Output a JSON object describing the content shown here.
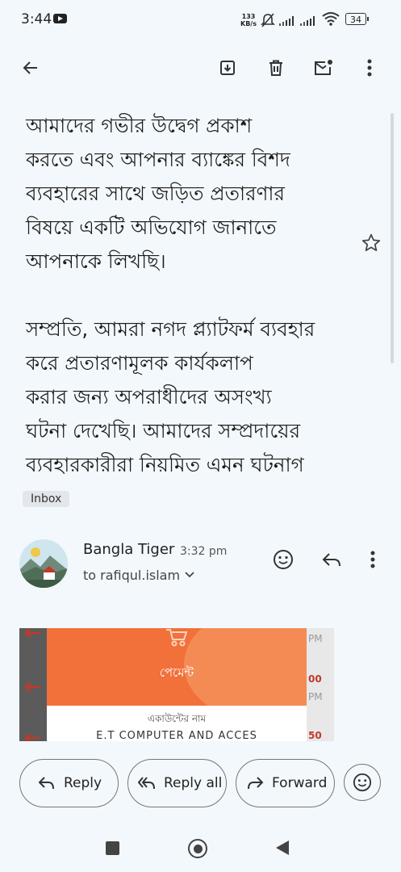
{
  "status_bar": {
    "time": "3:44",
    "net_speed_value": "133",
    "net_speed_unit": "KB/s",
    "battery": "34",
    "icons": [
      "youtube-icon",
      "mute-icon",
      "signal-icon",
      "signal-icon",
      "wifi-icon",
      "battery-icon"
    ]
  },
  "toolbar": {
    "icons": [
      "back-arrow-icon",
      "archive-icon",
      "delete-icon",
      "mark-unread-icon",
      "more-vert-icon"
    ]
  },
  "email": {
    "paragraphs": [
      [
        "আমাদের গভীর উদ্বেগ প্রকাশ",
        "করতে এবং আপনার ব্যাঙ্কের বিশদ",
        "ব্যবহারের সাথে জড়িত প্রতারণার",
        "বিষয়ে একটি অভিযোগ জানাতে",
        "আপনাকে লিখছি।"
      ],
      [
        "সম্প্রতি, আমরা নগদ প্ল্যাটফর্ম ব্যবহার",
        "করে প্রতারণামূলক কার্যকলাপ",
        "করার জন্য অপরাধীদের অসংখ্য",
        "ঘটনা দেখেছি। আমাদের সম্প্রদায়ের",
        "ব্যবহারকারীরা নিয়মিত এমন ঘটনাগ"
      ]
    ],
    "label_chip": "Inbox"
  },
  "sender": {
    "name": "Bangla Tiger",
    "time": "3:32 pm",
    "recipient": "to rafiqul.islam"
  },
  "attachment": {
    "title": "পেমেন্ট",
    "account_label": "একাউন্টের নাম",
    "company": "E.T COMPUTER AND ACCES",
    "side_texts": [
      "PM",
      "00",
      "PM",
      "50"
    ]
  },
  "actions": {
    "reply": "Reply",
    "reply_all": "Reply all",
    "forward": "Forward"
  },
  "colors": {
    "background": "#f3f8fc",
    "attachment_orange": "#f2703a",
    "side_red": "#c0392b"
  }
}
